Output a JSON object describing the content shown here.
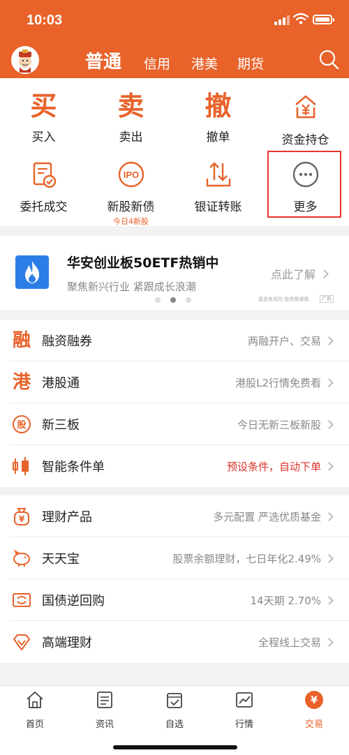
{
  "status": {
    "time": "10:03"
  },
  "header": {
    "tabs": [
      {
        "label": "普通",
        "active": true
      },
      {
        "label": "信用"
      },
      {
        "label": "港美"
      },
      {
        "label": "期货"
      }
    ],
    "avatar_icon": "god-of-wealth-avatar",
    "search_icon": "search-icon"
  },
  "grid": {
    "items": [
      {
        "glyph": "买",
        "label": "买入"
      },
      {
        "glyph": "卖",
        "label": "卖出"
      },
      {
        "glyph": "撤",
        "label": "撤单"
      },
      {
        "icon": "money-bag-icon",
        "label": "资金持仓"
      },
      {
        "icon": "document-check-icon",
        "label": "委托成交"
      },
      {
        "icon": "ipo-icon",
        "label": "新股新债",
        "sub": "今日4新股"
      },
      {
        "icon": "transfer-arrows-icon",
        "label": "银证转账"
      },
      {
        "icon": "more-dots-icon",
        "label": "更多"
      }
    ]
  },
  "banner": {
    "title": "华安创业板50ETF热销中",
    "subtitle": "聚焦新兴行业  紧跟成长浪潮",
    "link": "点此了解",
    "disclaimer": "基金有风险 投资需谨慎",
    "ad_tag": "广告",
    "dots_active": 1
  },
  "list1": [
    {
      "glyph": "融",
      "label": "融资融券",
      "value": "两融开户、交易"
    },
    {
      "glyph": "港",
      "label": "港股通",
      "value": "港股L2行情免费看"
    },
    {
      "icon": "stock-badge-icon",
      "label": "新三板",
      "value": "今日无新三板新股"
    },
    {
      "icon": "smart-order-icon",
      "label": "智能条件单",
      "value": "预设条件，自动下单",
      "highlight": true
    }
  ],
  "list2": [
    {
      "icon": "yen-bag-icon",
      "label": "理财产品",
      "value": "多元配置 严选优质基金"
    },
    {
      "icon": "piggy-bank-icon",
      "label": "天天宝",
      "value": "股票余额理财，七日年化2.49%"
    },
    {
      "icon": "bond-repo-icon",
      "label": "国债逆回购",
      "value": "14天期 2.70%"
    },
    {
      "icon": "diamond-icon",
      "label": "高端理财",
      "value": "全程线上交易"
    }
  ],
  "tabbar": [
    {
      "icon": "home-icon",
      "label": "首页"
    },
    {
      "icon": "news-icon",
      "label": "资讯"
    },
    {
      "icon": "watchlist-icon",
      "label": "自选"
    },
    {
      "icon": "market-chart-icon",
      "label": "行情"
    },
    {
      "icon": "trade-yen-icon",
      "label": "交易",
      "active": true
    }
  ],
  "colors": {
    "brand": "#e8622a",
    "highlight_red": "#d8342a",
    "banner_icon": "#2b7ee6"
  }
}
